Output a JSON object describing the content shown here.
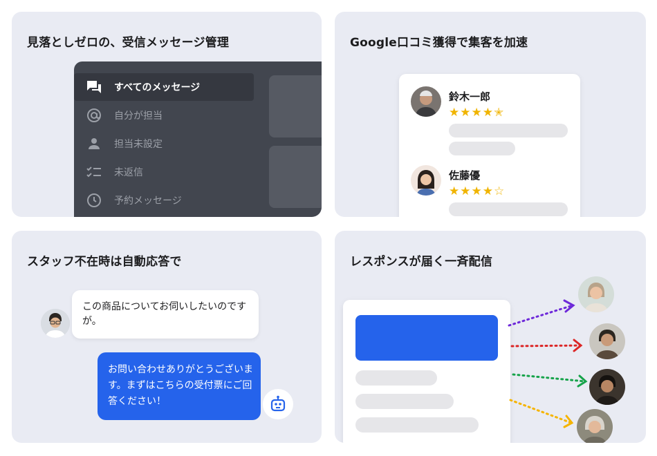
{
  "cards": {
    "message_management": {
      "title": "見落としゼロの、受信メッセージ管理",
      "menu": [
        {
          "label": "すべてのメッセージ",
          "icon": "chat-bubbles-icon",
          "active": true
        },
        {
          "label": "自分が担当",
          "icon": "at-sign-icon",
          "active": false
        },
        {
          "label": "担当未設定",
          "icon": "person-icon",
          "active": false
        },
        {
          "label": "未返信",
          "icon": "checklist-icon",
          "active": false
        },
        {
          "label": "予約メッセージ",
          "icon": "clock-icon",
          "active": false
        }
      ]
    },
    "google_reviews": {
      "title": "Google口コミ獲得で集客を加速",
      "reviews": [
        {
          "name": "鈴木一郎",
          "stars": "★★★★✭",
          "rating": 4.5
        },
        {
          "name": "佐藤優",
          "stars": "★★★★☆",
          "rating": 4
        }
      ]
    },
    "auto_reply": {
      "title": "スタッフ不在時は自動応答で",
      "incoming": "この商品についてお伺いしたいのですが。",
      "outgoing": "お問い合わせありがとうございます。まずはこちらの受付票にご回答ください！"
    },
    "broadcast": {
      "title": "レスポンスが届く一斉配信",
      "arrow_colors": [
        "#6d28d9",
        "#dc2626",
        "#16a34a",
        "#f5b400"
      ]
    }
  },
  "colors": {
    "card_bg": "#e9ebf3",
    "dark_panel": "#42464f",
    "accent_blue": "#2563eb",
    "star_yellow": "#f0b400"
  }
}
